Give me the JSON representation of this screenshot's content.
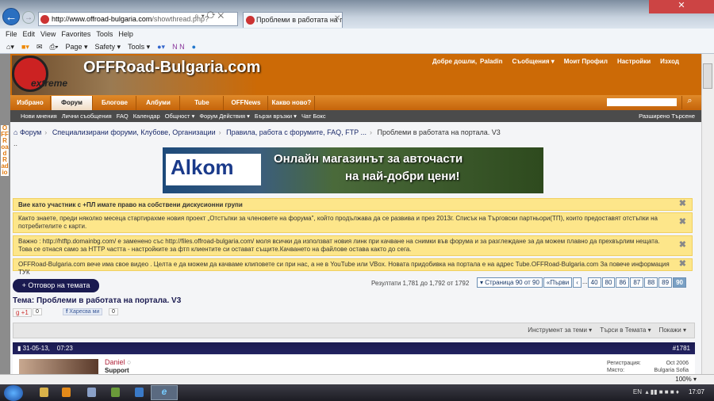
{
  "browser": {
    "url_domain": "http://www.offroad-bulgaria.com",
    "url_path": "/showthread.php?",
    "tab_title": "Проблеми в работата на п...",
    "menu": [
      "File",
      "Edit",
      "View",
      "Favorites",
      "Tools",
      "Help"
    ],
    "commands": [
      "Page ▾",
      "Safety ▾",
      "Tools ▾"
    ],
    "zoom": "100%"
  },
  "site": {
    "logo": "OFFRoad-Bulgaria.com",
    "logo_sub": "extreme",
    "radio": "OFFRoadRadio",
    "user_links": [
      "Добре дошли,",
      "Paladin",
      "Съобщения ▾",
      "Моит Профил",
      "Настройки",
      "Изход"
    ],
    "nav_tabs": [
      "Избрано",
      "Форум",
      "Блогове",
      "Албуми",
      "Tube",
      "OFFNews",
      "Какво ново?"
    ],
    "sub_nav": [
      "Нови мнения",
      "Лични съобщения",
      "FAQ",
      "Календар",
      "Общност ▾",
      "Форум Действия ▾",
      "Бързи връзки ▾",
      "Чат Бокс"
    ],
    "advanced_search": "Разширено Търсене"
  },
  "breadcrumb": [
    "Форум",
    "Специализирани форуми, Клубове, Организации",
    "Правила, работа с форумите, FAQ, FTP ...",
    "Проблеми в работата на портала. V3"
  ],
  "breadcrumb_extra": "..",
  "banner": {
    "logo": "Alkom",
    "line1": "Онлайн магазинът за авточасти",
    "line2": "на най-добри цени!"
  },
  "notices": [
    "Вие като участник с +ПЛ имате право на собствени дискусионни групи",
    "Както знаете, преди няколко месеца стартирахме новия проект „Отстъпки за членовете на форума\", който продължава да се развива и през 2013г. Списък на Търговски партньори(ТП), които предоставят отстъпки на потребителите с карти.",
    "Важно : http://htftp.domainbg.com/ е заменено със http://files.offroad-bulgaria.com/ моля всички да използват новия линк при качване на снимки във форума и за разглеждане за да можем плавно да прехвърлим нещата. Това се отнася само за HTTP частта - настройките за фтп клиентите си остават същите.Качването на файлове остава както до сега.",
    "OFFRoad-Bulgaria.com вече има свое видео . Целта е да можем да качваме клиповете си при нас, а не в YouTube или VBox. Новата придобивка на портала е на адрес Tube.OFFRoad-Bulgaria.com За повече информация ТУК"
  ],
  "thread": {
    "reply_button": "+ Отговор на темата",
    "results": "Резултати 1,781 до 1,792 от 1792",
    "page_label": "▾ Страница 90 от 90",
    "first": "«Първи",
    "prev": "‹",
    "ellipsis": "...",
    "pages": [
      "40",
      "80",
      "86",
      "87",
      "88",
      "89",
      "90"
    ],
    "current_page": "90",
    "title": "Тема: Проблеми в работата на портала. V3",
    "gplus": "+1",
    "gplus_count": "0",
    "fb_like": "Харесва ми",
    "fb_count": "0",
    "tools": [
      "Инструмент за теми ▾",
      "Търси в Темата ▾",
      "Покажи ▾"
    ]
  },
  "post": {
    "date": "31-05-13,",
    "time": "07:23",
    "number": "#1781",
    "username": "Daniel",
    "user_title": "Support",
    "reg_label": "Регистрация:",
    "reg_value": "Oct 2006",
    "loc_label": "Място:",
    "loc_value": "Bulgaria Sofia"
  },
  "taskbar": {
    "lang": "EN",
    "clock": "17:07"
  }
}
